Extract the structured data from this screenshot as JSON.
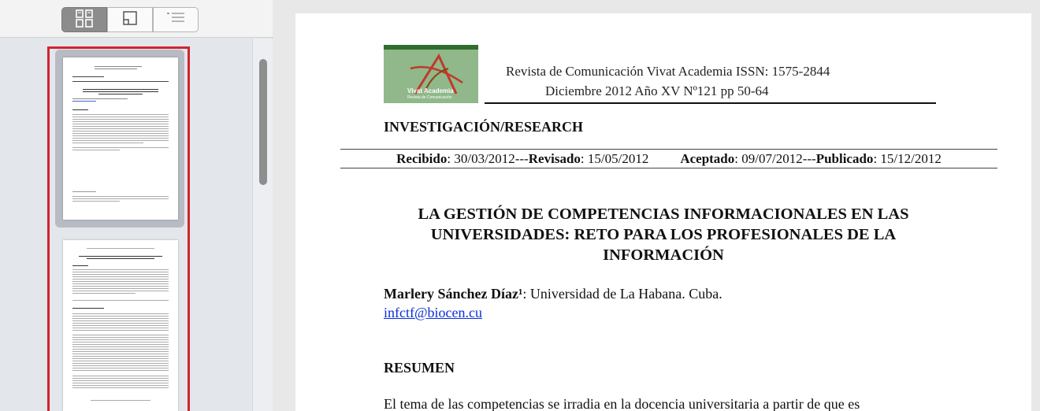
{
  "sidebar": {
    "view_buttons": [
      {
        "name": "thumbnails-view-button",
        "icon": "thumbnails-icon",
        "selected": true
      },
      {
        "name": "single-page-view-button",
        "icon": "page-corner-icon",
        "selected": false
      },
      {
        "name": "outline-view-button",
        "icon": "list-icon",
        "selected": false
      }
    ]
  },
  "document": {
    "journal_line": "Revista de Comunicación Vivat Academia     ISSN: 1575-2844",
    "issue_line": "Diciembre 2012     Año XV      Nº121       pp 50-64",
    "logo_title": "Vivat Academia",
    "logo_subtitle": "Revista de Comunicación",
    "section": "INVESTIGACIÓN/RESEARCH",
    "dates": {
      "received_label": "Recibido",
      "received": ": 30/03/2012---",
      "revised_label": "Revisado",
      "revised": ": 15/05/2012",
      "accepted_label": "Aceptado",
      "accepted": ": 09/07/2012---",
      "published_label": "Publicado",
      "published": ": 15/12/2012"
    },
    "title": "LA GESTIÓN DE COMPETENCIAS INFORMACIONALES EN LAS UNIVERSIDADES: RETO PARA LOS PROFESIONALES DE LA INFORMACIÓN",
    "author_name": "Marlery Sánchez Díaz¹",
    "author_affil": ": Universidad de La Habana. Cuba.",
    "email": "infctf@biocen.cu",
    "abstract_heading": "RESUMEN",
    "abstract_start": "El tema de las competencias se irradia en la docencia universitaria a partir de que es"
  },
  "colors": {
    "selection_border": "#d0242f",
    "link": "#0b2fd8",
    "logo_green": "#90b88a"
  }
}
